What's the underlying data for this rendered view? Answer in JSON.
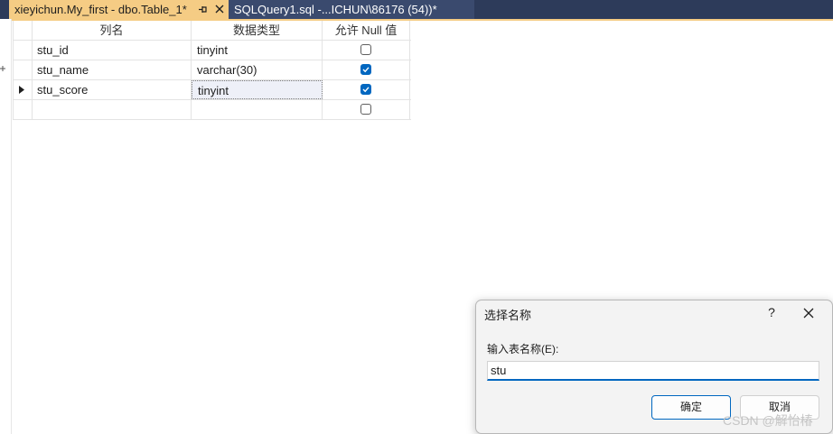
{
  "tabs": {
    "active": {
      "title": "xieyichun.My_first - dbo.Table_1*",
      "pin_icon": "pin-icon",
      "close_icon": "close-icon"
    },
    "inactive": {
      "title": "SQLQuery1.sql -...ICHUN\\86176 (54))*"
    }
  },
  "grid": {
    "headers": {
      "column_name": "列名",
      "data_type": "数据类型",
      "allow_null": "允许 Null 值"
    },
    "rows": [
      {
        "name": "stu_id",
        "type": "tinyint",
        "allow_null": false,
        "current": false
      },
      {
        "name": "stu_name",
        "type": "varchar(30)",
        "allow_null": true,
        "current": false
      },
      {
        "name": "stu_score",
        "type": "tinyint",
        "allow_null": true,
        "current": true
      },
      {
        "name": "",
        "type": "",
        "allow_null": false,
        "current": false
      }
    ]
  },
  "dialog": {
    "title": "选择名称",
    "help_label": "?",
    "label": "输入表名称(E):",
    "input_value": "stu",
    "ok_label": "确定",
    "cancel_label": "取消"
  },
  "watermark": "CSDN @解怡椿",
  "colors": {
    "accent": "#0067c0",
    "active_tab": "#f5cc84",
    "tab_strip": "#2d3b5a"
  }
}
